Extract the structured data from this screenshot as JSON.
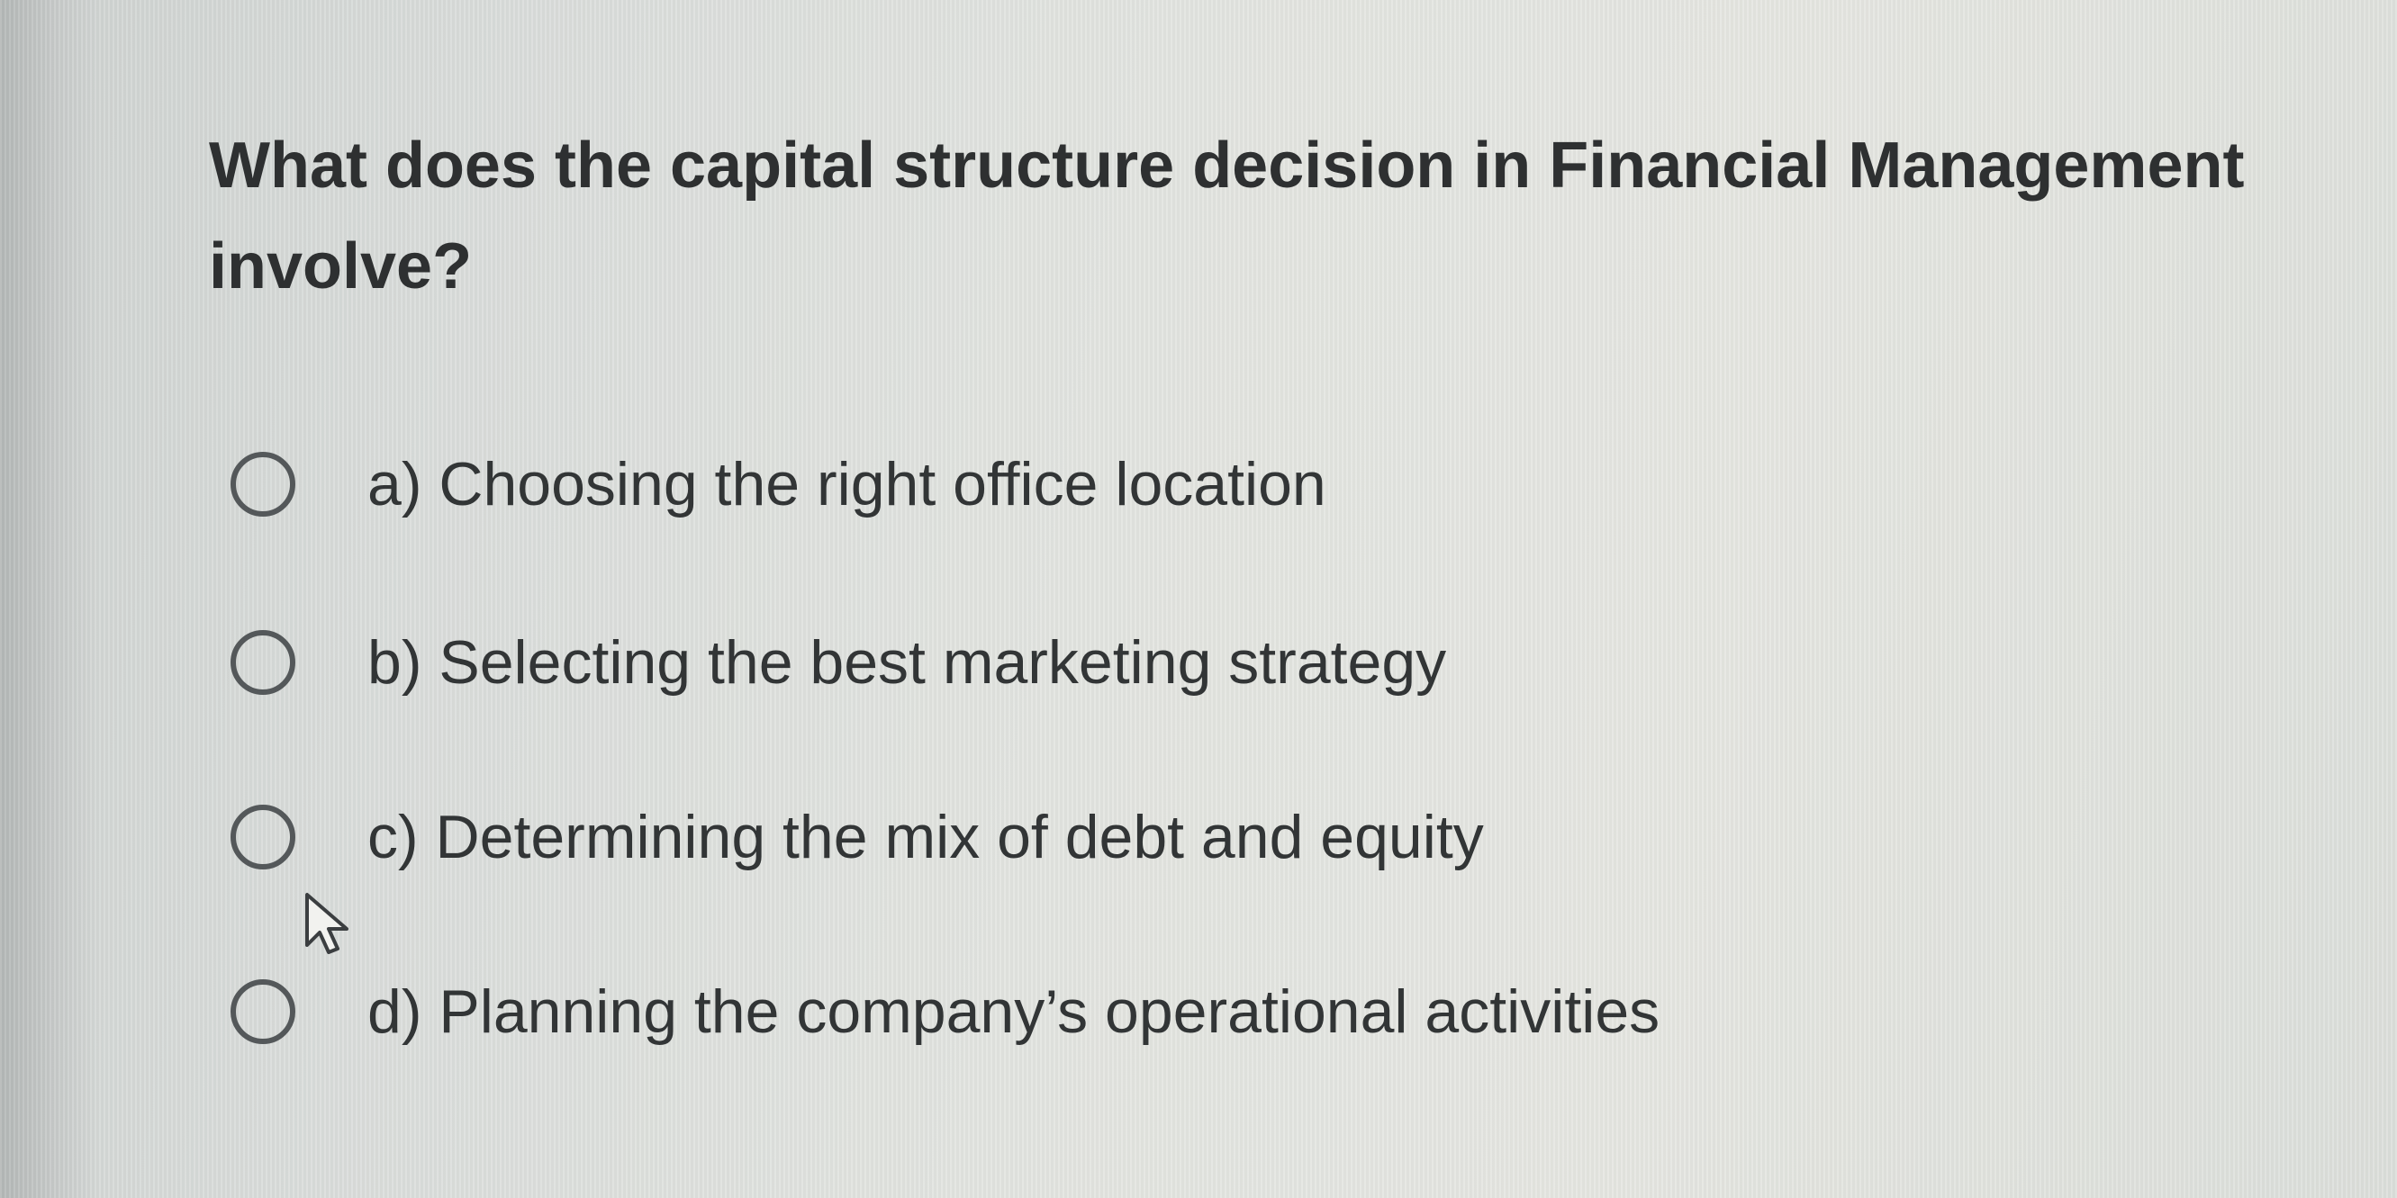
{
  "question": {
    "text": "What does the capital structure decision in Financial Management involve?"
  },
  "options": [
    {
      "label": "a) Choosing the right office location",
      "selected": false
    },
    {
      "label": "b) Selecting the best marketing strategy",
      "selected": false
    },
    {
      "label": "c) Determining the mix of debt and equity",
      "selected": false
    },
    {
      "label": "d) Planning the company’s operational activities",
      "selected": false
    }
  ],
  "icons": {
    "radio": "radio-button-unselected-icon",
    "cursor": "mouse-pointer-icon"
  }
}
